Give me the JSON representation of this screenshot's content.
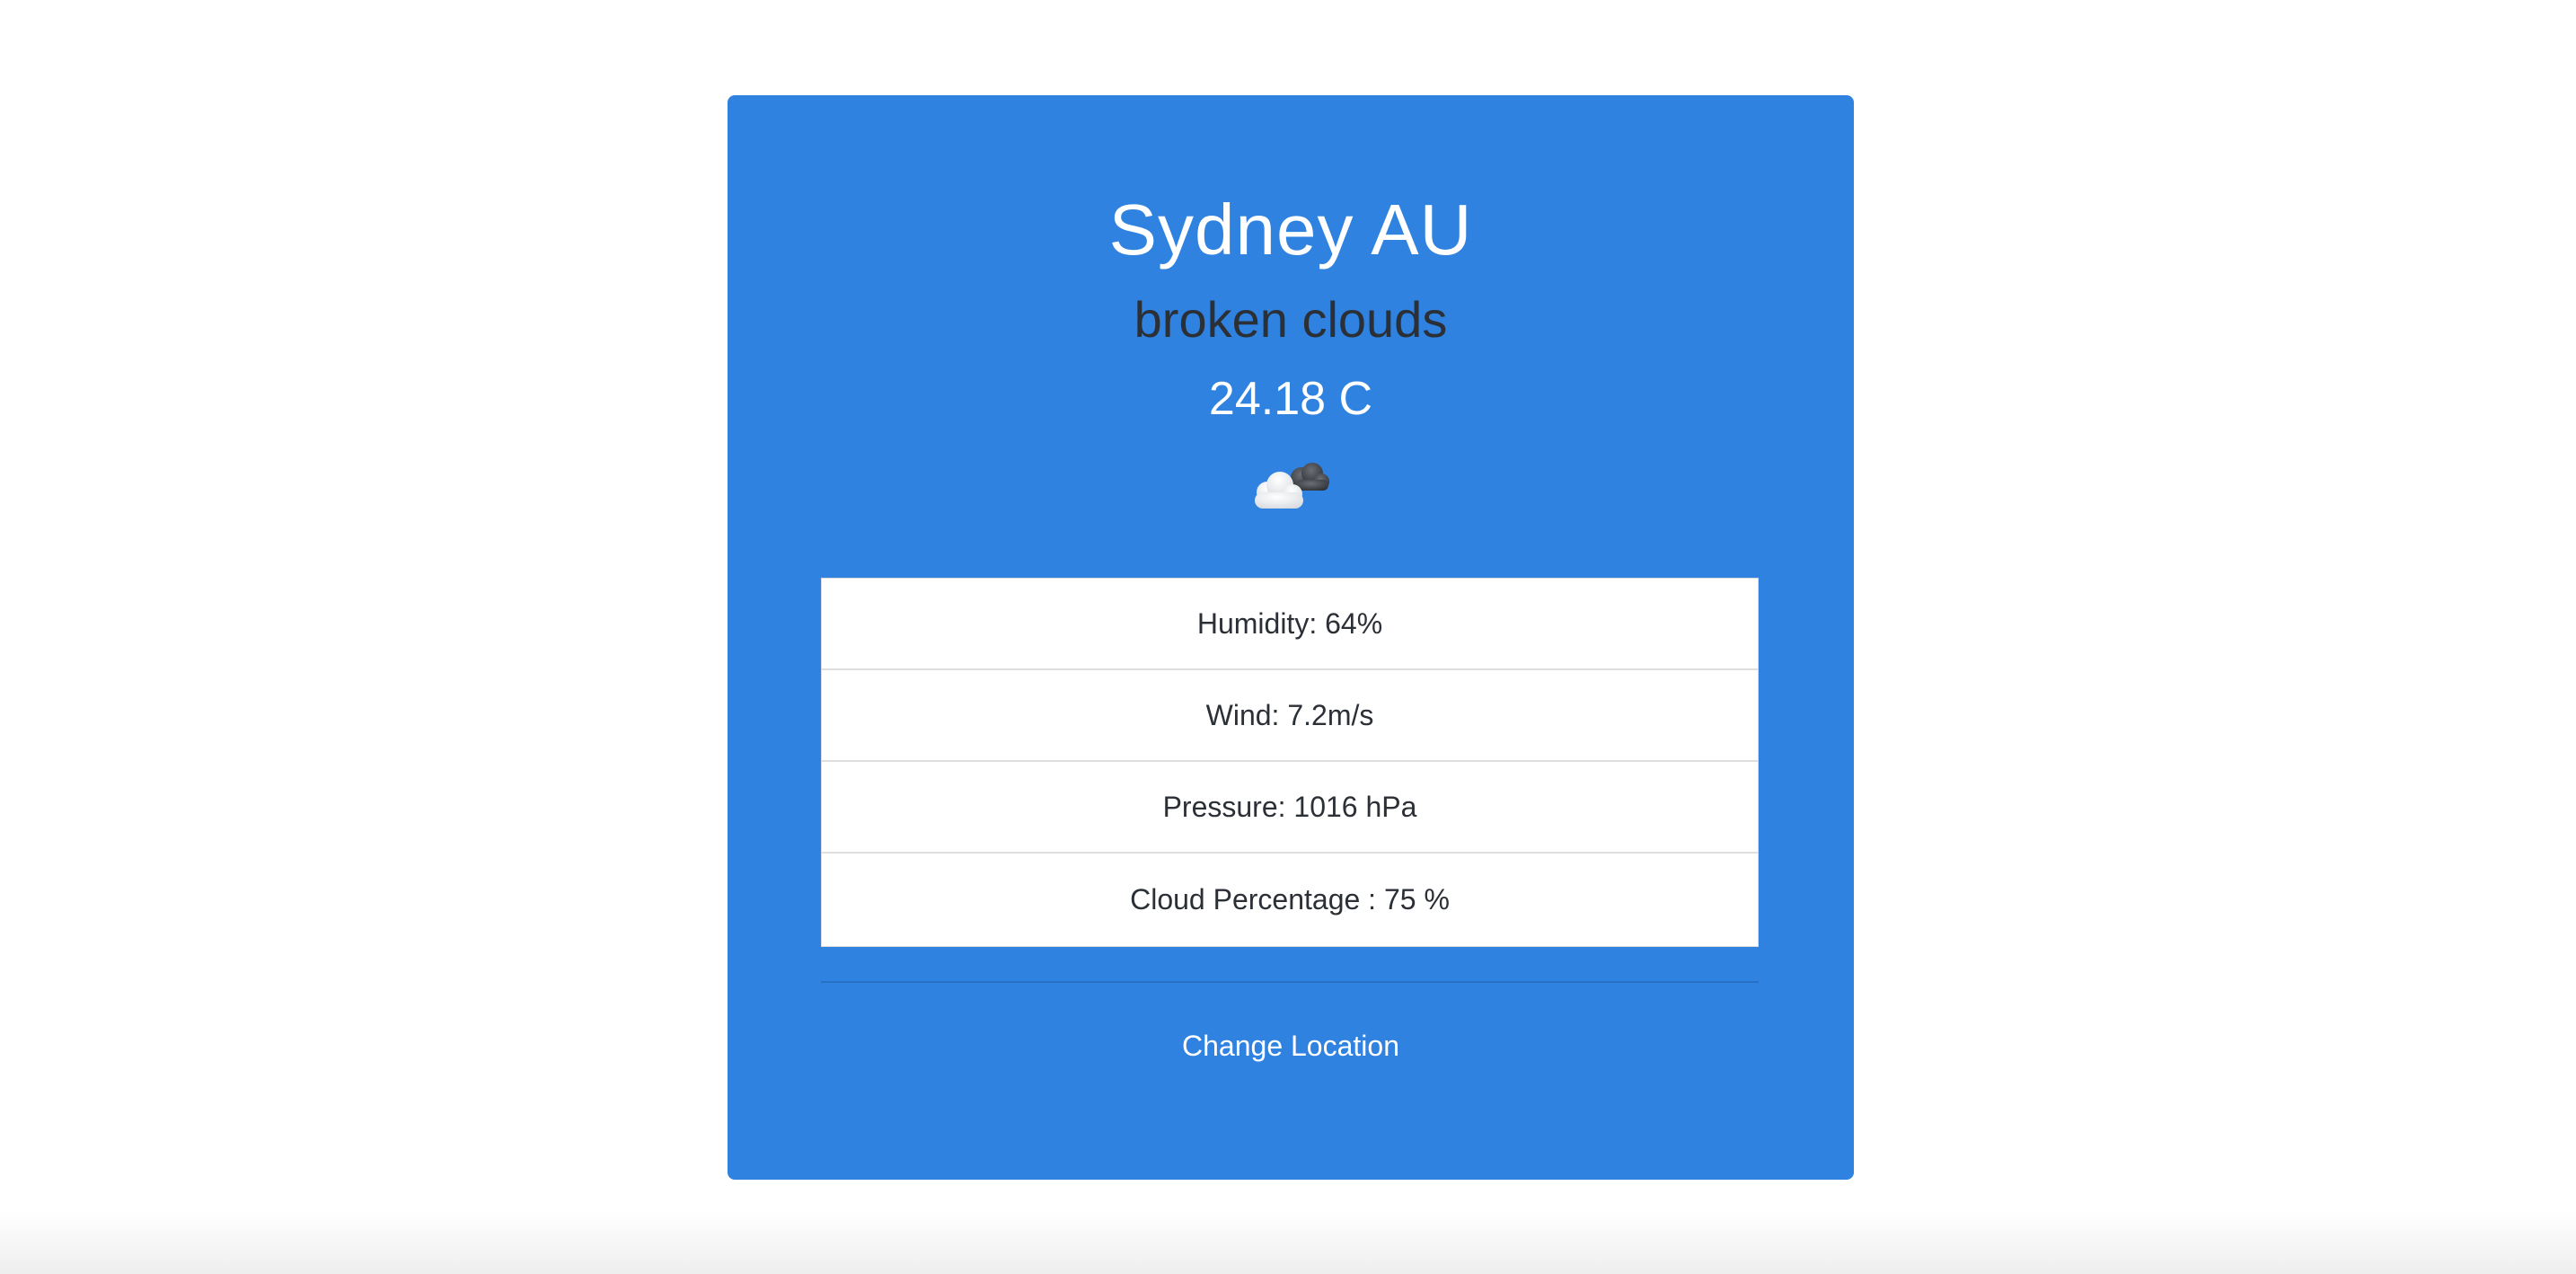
{
  "weather": {
    "location": "Sydney AU",
    "description": "broken clouds",
    "temperature": "24.18 C",
    "icon": "broken-clouds-icon"
  },
  "details": [
    {
      "text": "Humidity: 64%"
    },
    {
      "text": "Wind: 7.2m/s"
    },
    {
      "text": "Pressure: 1016 hPa"
    },
    {
      "text": "Cloud Percentage : 75 %"
    }
  ],
  "actions": {
    "change_location": "Change Location"
  },
  "colors": {
    "card_background": "#2f82e0",
    "text_light": "#ffffff",
    "text_dark": "#2b2f36"
  }
}
